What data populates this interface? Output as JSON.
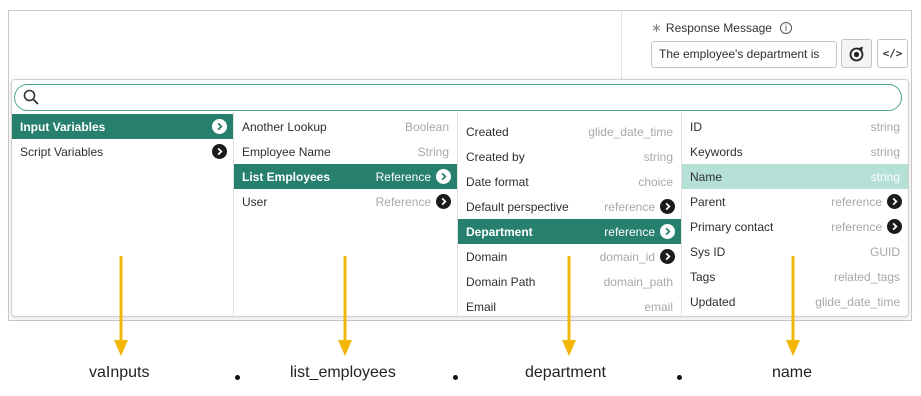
{
  "response": {
    "label": "Response Message",
    "required_mark": "∗",
    "value": "The employee's department is"
  },
  "search": {
    "value": ""
  },
  "columns": [
    {
      "rows": [
        {
          "name": "Input Variables",
          "type": "",
          "arrow": true,
          "state": "selected"
        },
        {
          "name": "Script Variables",
          "type": "",
          "arrow": true,
          "state": ""
        }
      ]
    },
    {
      "rows": [
        {
          "name": "Another Lookup",
          "type": "Boolean",
          "arrow": false,
          "state": ""
        },
        {
          "name": "Employee Name",
          "type": "String",
          "arrow": false,
          "state": ""
        },
        {
          "name": "List Employees",
          "type": "Reference",
          "arrow": true,
          "state": "selected"
        },
        {
          "name": "User",
          "type": "Reference",
          "arrow": true,
          "state": ""
        }
      ]
    },
    {
      "rows": [
        {
          "name": "Created",
          "type": "glide_date_time",
          "arrow": false,
          "state": ""
        },
        {
          "name": "Created by",
          "type": "string",
          "arrow": false,
          "state": ""
        },
        {
          "name": "Date format",
          "type": "choice",
          "arrow": false,
          "state": ""
        },
        {
          "name": "Default perspective",
          "type": "reference",
          "arrow": true,
          "state": ""
        },
        {
          "name": "Department",
          "type": "reference",
          "arrow": true,
          "state": "selected"
        },
        {
          "name": "Domain",
          "type": "domain_id",
          "arrow": true,
          "state": ""
        },
        {
          "name": "Domain Path",
          "type": "domain_path",
          "arrow": false,
          "state": ""
        },
        {
          "name": "Email",
          "type": "email",
          "arrow": false,
          "state": ""
        }
      ]
    },
    {
      "rows": [
        {
          "name": "ID",
          "type": "string",
          "arrow": false,
          "state": ""
        },
        {
          "name": "Keywords",
          "type": "string",
          "arrow": false,
          "state": ""
        },
        {
          "name": "Name",
          "type": "string",
          "arrow": false,
          "state": "highlight"
        },
        {
          "name": "Parent",
          "type": "reference",
          "arrow": true,
          "state": ""
        },
        {
          "name": "Primary contact",
          "type": "reference",
          "arrow": true,
          "state": ""
        },
        {
          "name": "Sys ID",
          "type": "GUID",
          "arrow": false,
          "state": ""
        },
        {
          "name": "Tags",
          "type": "related_tags",
          "arrow": false,
          "state": ""
        },
        {
          "name": "Updated",
          "type": "glide_date_time",
          "arrow": false,
          "state": ""
        }
      ]
    }
  ],
  "annotations": {
    "labels": [
      "vaInputs",
      "list_employees",
      "department",
      "name"
    ],
    "arrow_color": "#f2b705"
  },
  "colors": {
    "selected_row": "#27806d",
    "highlight_row": "#b5e0d6",
    "search_border": "#4aa493"
  }
}
